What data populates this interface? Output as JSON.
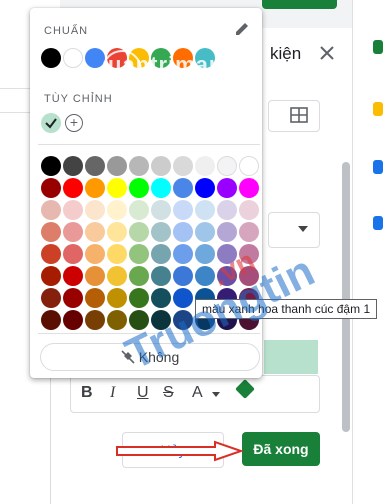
{
  "panel": {
    "title": "kiện",
    "cancel_label": "Hủy",
    "done_label": "Đã xong",
    "format_buttons": {
      "bold": "B",
      "italic": "I",
      "underline": "U",
      "strike": "S",
      "text_color": "A"
    }
  },
  "picker": {
    "standard_label": "CHUẨN",
    "custom_label": "TÙY CHỈNH",
    "add_custom": "+",
    "none_label": "Không",
    "standard_colors": [
      "#000000",
      "#ffffff",
      "#4285f4",
      "#ea4335",
      "#fbbc04",
      "#34a853",
      "#ff6d01",
      "#46bdc6"
    ],
    "custom_colors": [
      "#b7e1cd"
    ],
    "palette": [
      [
        "#000000",
        "#434343",
        "#666666",
        "#999999",
        "#b7b7b7",
        "#cccccc",
        "#d9d9d9",
        "#efefef",
        "#f3f3f3",
        "#ffffff"
      ],
      [
        "#980000",
        "#ff0000",
        "#ff9900",
        "#ffff00",
        "#00ff00",
        "#00ffff",
        "#4a86e8",
        "#0000ff",
        "#9900ff",
        "#ff00ff"
      ],
      [
        "#e6b8af",
        "#f4cccc",
        "#fce5cd",
        "#fff2cc",
        "#d9ead3",
        "#d0e0e3",
        "#c9daf8",
        "#cfe2f3",
        "#d9d2e9",
        "#ead1dc"
      ],
      [
        "#dd7e6b",
        "#ea9999",
        "#f9cb9c",
        "#ffe599",
        "#b6d7a8",
        "#a2c4c9",
        "#a4c2f4",
        "#9fc5e8",
        "#b4a7d6",
        "#d5a6bd"
      ],
      [
        "#cc4125",
        "#e06666",
        "#f6b26b",
        "#ffd966",
        "#93c47d",
        "#76a5af",
        "#6d9eeb",
        "#6fa8dc",
        "#8e7cc3",
        "#c27ba0"
      ],
      [
        "#a61c00",
        "#cc0000",
        "#e69138",
        "#f1c232",
        "#6aa84f",
        "#45818e",
        "#3c78d8",
        "#3d85c6",
        "#674ea7",
        "#a64d79"
      ],
      [
        "#85200c",
        "#990000",
        "#b45f06",
        "#bf9000",
        "#38761d",
        "#134f5c",
        "#1155cc",
        "#0b5394",
        "#351c75",
        "#741b47"
      ],
      [
        "#5b0f00",
        "#660000",
        "#783f04",
        "#7f6000",
        "#274e13",
        "#0c343d",
        "#1c4587",
        "#073763",
        "#20124d",
        "#4c1130"
      ]
    ],
    "tooltip": "màu xanh hoa thanh cúc đậm 1"
  },
  "watermarks": {
    "top": "uantrimang",
    "blue": "Truongtin",
    "red": ".vn"
  },
  "colors": {
    "accent_green": "#188038",
    "link_blue": "#1a73e8"
  }
}
